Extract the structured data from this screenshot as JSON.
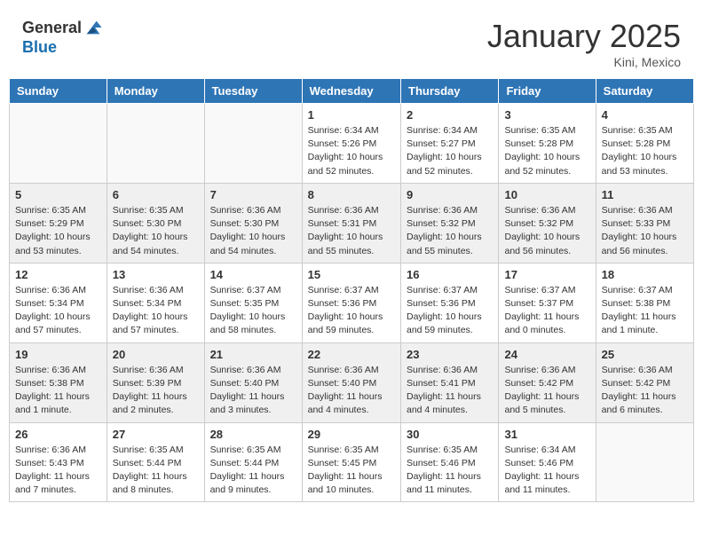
{
  "header": {
    "logo_general": "General",
    "logo_blue": "Blue",
    "title": "January 2025",
    "subtitle": "Kini, Mexico"
  },
  "weekdays": [
    "Sunday",
    "Monday",
    "Tuesday",
    "Wednesday",
    "Thursday",
    "Friday",
    "Saturday"
  ],
  "weeks": [
    [
      {
        "day": "",
        "info": ""
      },
      {
        "day": "",
        "info": ""
      },
      {
        "day": "",
        "info": ""
      },
      {
        "day": "1",
        "info": "Sunrise: 6:34 AM\nSunset: 5:26 PM\nDaylight: 10 hours\nand 52 minutes."
      },
      {
        "day": "2",
        "info": "Sunrise: 6:34 AM\nSunset: 5:27 PM\nDaylight: 10 hours\nand 52 minutes."
      },
      {
        "day": "3",
        "info": "Sunrise: 6:35 AM\nSunset: 5:28 PM\nDaylight: 10 hours\nand 52 minutes."
      },
      {
        "day": "4",
        "info": "Sunrise: 6:35 AM\nSunset: 5:28 PM\nDaylight: 10 hours\nand 53 minutes."
      }
    ],
    [
      {
        "day": "5",
        "info": "Sunrise: 6:35 AM\nSunset: 5:29 PM\nDaylight: 10 hours\nand 53 minutes."
      },
      {
        "day": "6",
        "info": "Sunrise: 6:35 AM\nSunset: 5:30 PM\nDaylight: 10 hours\nand 54 minutes."
      },
      {
        "day": "7",
        "info": "Sunrise: 6:36 AM\nSunset: 5:30 PM\nDaylight: 10 hours\nand 54 minutes."
      },
      {
        "day": "8",
        "info": "Sunrise: 6:36 AM\nSunset: 5:31 PM\nDaylight: 10 hours\nand 55 minutes."
      },
      {
        "day": "9",
        "info": "Sunrise: 6:36 AM\nSunset: 5:32 PM\nDaylight: 10 hours\nand 55 minutes."
      },
      {
        "day": "10",
        "info": "Sunrise: 6:36 AM\nSunset: 5:32 PM\nDaylight: 10 hours\nand 56 minutes."
      },
      {
        "day": "11",
        "info": "Sunrise: 6:36 AM\nSunset: 5:33 PM\nDaylight: 10 hours\nand 56 minutes."
      }
    ],
    [
      {
        "day": "12",
        "info": "Sunrise: 6:36 AM\nSunset: 5:34 PM\nDaylight: 10 hours\nand 57 minutes."
      },
      {
        "day": "13",
        "info": "Sunrise: 6:36 AM\nSunset: 5:34 PM\nDaylight: 10 hours\nand 57 minutes."
      },
      {
        "day": "14",
        "info": "Sunrise: 6:37 AM\nSunset: 5:35 PM\nDaylight: 10 hours\nand 58 minutes."
      },
      {
        "day": "15",
        "info": "Sunrise: 6:37 AM\nSunset: 5:36 PM\nDaylight: 10 hours\nand 59 minutes."
      },
      {
        "day": "16",
        "info": "Sunrise: 6:37 AM\nSunset: 5:36 PM\nDaylight: 10 hours\nand 59 minutes."
      },
      {
        "day": "17",
        "info": "Sunrise: 6:37 AM\nSunset: 5:37 PM\nDaylight: 11 hours\nand 0 minutes."
      },
      {
        "day": "18",
        "info": "Sunrise: 6:37 AM\nSunset: 5:38 PM\nDaylight: 11 hours\nand 1 minute."
      }
    ],
    [
      {
        "day": "19",
        "info": "Sunrise: 6:36 AM\nSunset: 5:38 PM\nDaylight: 11 hours\nand 1 minute."
      },
      {
        "day": "20",
        "info": "Sunrise: 6:36 AM\nSunset: 5:39 PM\nDaylight: 11 hours\nand 2 minutes."
      },
      {
        "day": "21",
        "info": "Sunrise: 6:36 AM\nSunset: 5:40 PM\nDaylight: 11 hours\nand 3 minutes."
      },
      {
        "day": "22",
        "info": "Sunrise: 6:36 AM\nSunset: 5:40 PM\nDaylight: 11 hours\nand 4 minutes."
      },
      {
        "day": "23",
        "info": "Sunrise: 6:36 AM\nSunset: 5:41 PM\nDaylight: 11 hours\nand 4 minutes."
      },
      {
        "day": "24",
        "info": "Sunrise: 6:36 AM\nSunset: 5:42 PM\nDaylight: 11 hours\nand 5 minutes."
      },
      {
        "day": "25",
        "info": "Sunrise: 6:36 AM\nSunset: 5:42 PM\nDaylight: 11 hours\nand 6 minutes."
      }
    ],
    [
      {
        "day": "26",
        "info": "Sunrise: 6:36 AM\nSunset: 5:43 PM\nDaylight: 11 hours\nand 7 minutes."
      },
      {
        "day": "27",
        "info": "Sunrise: 6:35 AM\nSunset: 5:44 PM\nDaylight: 11 hours\nand 8 minutes."
      },
      {
        "day": "28",
        "info": "Sunrise: 6:35 AM\nSunset: 5:44 PM\nDaylight: 11 hours\nand 9 minutes."
      },
      {
        "day": "29",
        "info": "Sunrise: 6:35 AM\nSunset: 5:45 PM\nDaylight: 11 hours\nand 10 minutes."
      },
      {
        "day": "30",
        "info": "Sunrise: 6:35 AM\nSunset: 5:46 PM\nDaylight: 11 hours\nand 11 minutes."
      },
      {
        "day": "31",
        "info": "Sunrise: 6:34 AM\nSunset: 5:46 PM\nDaylight: 11 hours\nand 11 minutes."
      },
      {
        "day": "",
        "info": ""
      }
    ]
  ]
}
